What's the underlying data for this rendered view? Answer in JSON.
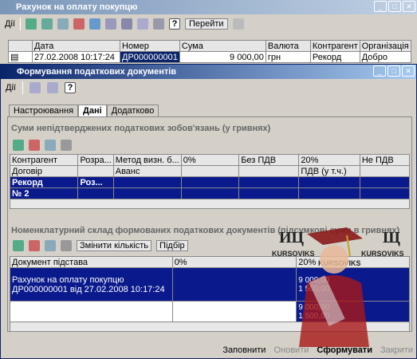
{
  "bg_window": {
    "title": "Рахунок на оплату покупцю",
    "toolbar": {
      "actions": "Дії",
      "go": "Перейти"
    },
    "columns": [
      "Дата",
      "Номер",
      "Сума",
      "Валюта",
      "Контрагент",
      "Організація"
    ],
    "row": {
      "date": "27.02.2008 10:17:24",
      "number": "ДР000000001",
      "sum": "9 000,00",
      "currency": "грн",
      "counterparty": "Рекорд",
      "organization": "Добро"
    }
  },
  "fg_window": {
    "title": "Формування податкових документів",
    "toolbar": {
      "actions": "Дії"
    },
    "tabs": [
      "Настроювання",
      "Дані",
      "Додатково"
    ],
    "section1": {
      "title": "Суми непідтверджених податкових зобов'язань (у гривнях)",
      "columns": [
        "Контрагент",
        "Розра...",
        "Метод визн. б...",
        "0%",
        "Без ПДВ",
        "20%",
        "Не ПДВ"
      ],
      "subcolumns": [
        "Договір",
        "",
        "Аванс",
        "",
        "",
        "ПДВ (у т.ч.)",
        ""
      ],
      "rows": [
        [
          "Рекорд",
          "Роз...",
          "",
          "",
          "",
          "",
          ""
        ],
        [
          "№ 2",
          "",
          "",
          "",
          "",
          "",
          ""
        ]
      ]
    },
    "section2": {
      "title": "Номенклатурний склад формованих податкових документів (підсумкові суми в гривнях)",
      "buttons": {
        "change_qty": "Змінити кількість",
        "select": "Підбір"
      },
      "columns": [
        "Документ підстава",
        "0%",
        "20%"
      ],
      "row_text": "Рахунок на оплату покупцю ДР000000001 від 27.02.2008 10:17:24",
      "values": [
        "9 000,00",
        "1 500,00",
        "9 000,00",
        "1 500,00"
      ]
    },
    "footer": {
      "fill": "Заповнити",
      "update": "Оновити",
      "form": "Сформувати",
      "close": "Закрити"
    }
  },
  "watermark": {
    "left": "ИЦ",
    "right": "Щ",
    "brand_left": "KURSOVIKS",
    "brand_center": "KURSOVIKS",
    "brand_right": "KURSOVIKS"
  },
  "colors": {
    "title_blue": "#0a246a",
    "title_grad": "#a6caf0",
    "select": "#0a1a8c",
    "panel": "#d4d0c8"
  }
}
